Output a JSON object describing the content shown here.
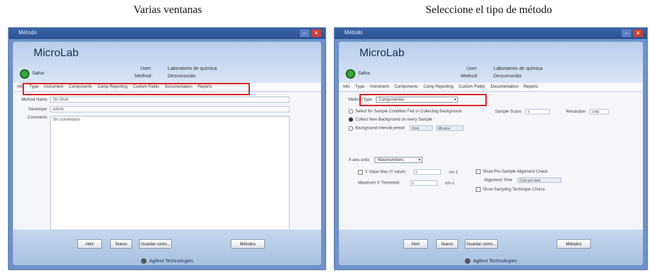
{
  "captions": {
    "left": "Varias ventanas",
    "right": "Seleccione el tipo de método"
  },
  "window": {
    "title": "Método",
    "minimize": "–",
    "close": "✕"
  },
  "brand": "MicroLab",
  "header": {
    "user_label": "User:",
    "user_value": "Laboratorio de química",
    "method_label": "Method:",
    "method_value": "Desconocido",
    "round_button_label": "Salvo"
  },
  "left": {
    "tabs": [
      "Info",
      "Type",
      "Instrument",
      "Components",
      "Comp Reporting",
      "Custom Fields",
      "Documentation",
      "Reports"
    ],
    "fields": [
      {
        "label": "Method Name",
        "value": "Sin título"
      },
      {
        "label": "Developer",
        "value": "admin"
      },
      {
        "label": "Comments",
        "value": "Sin comentario"
      }
    ],
    "buttons": [
      "Abrir",
      "Nuevo",
      "Guardar",
      "Guardar como...",
      "Métodos"
    ]
  },
  "right": {
    "tabs": [
      "Info",
      "Type",
      "Instrument",
      "Components",
      "Comp Reporting",
      "Custom Fields",
      "Documentation",
      "Reports"
    ],
    "method_type_label": "Method Type",
    "method_type_value": "Componentes",
    "radio1": "Select for Sample Condition Fed or Collecting Background",
    "scans_label": "Sample Scans",
    "scans_value": "4",
    "resolution_label": "Resolution",
    "resolution_value": "2048",
    "radio2": "Collect New Background on every Sample",
    "radio3": "Background Interval period",
    "interval_value": "2min",
    "interval_unit": "Minutos",
    "x_axis_label": "X axis units",
    "x_axis_value": "Wavenumbers",
    "xmax_label": "X Value Max (Y value)",
    "xmax_value": "0",
    "xmax_unit": "cm-1",
    "xthresh_label": "Maximum X Threshold",
    "xthresh_value": "0",
    "xthresh_unit": "cm-1",
    "chk1": "Show Pre-Sample Alignment Check",
    "alignment_label": "Alignment Time",
    "alignment_value": "Ciclo por fase",
    "chk2": "Show Sampling Technique Choice",
    "buttons": [
      "Abrir",
      "Nuevo",
      "Guardar",
      "Guardar como...",
      "Métodos"
    ]
  },
  "footer_brand": "Agilent Technologies"
}
